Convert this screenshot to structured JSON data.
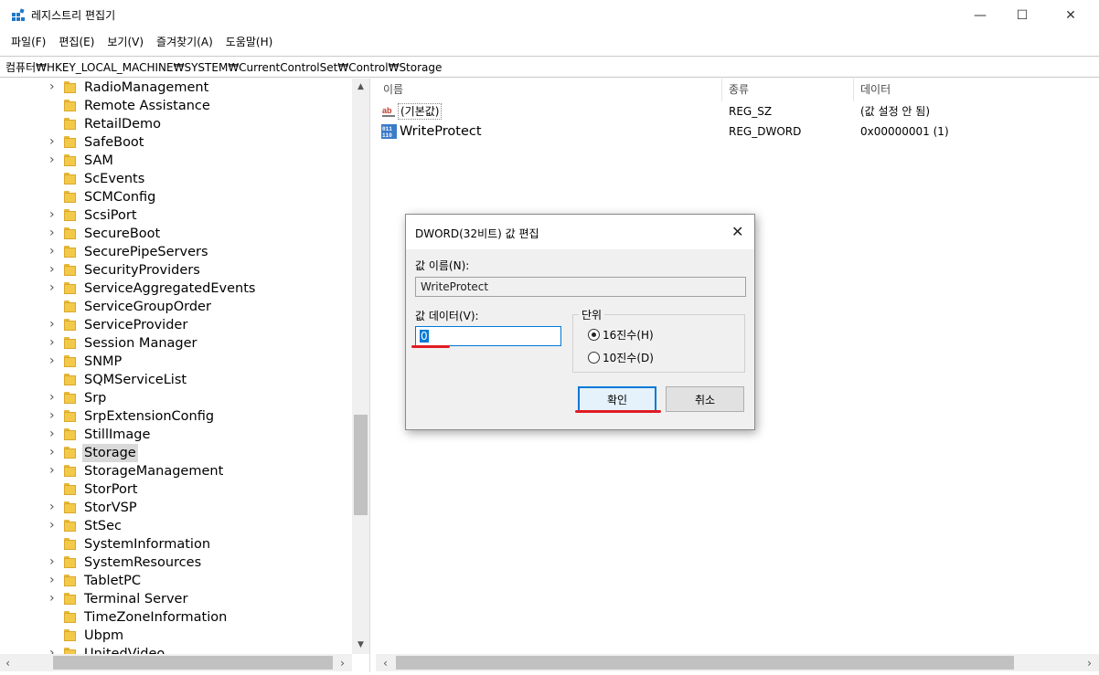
{
  "window": {
    "title": "레지스트리 편집기",
    "min_glyph": "—",
    "max_glyph": "☐",
    "close_glyph": "✕"
  },
  "menu": [
    "파일(F)",
    "편집(E)",
    "보기(V)",
    "즐겨찾기(A)",
    "도움말(H)"
  ],
  "address": "컴퓨터₩HKEY_LOCAL_MACHINE₩SYSTEM₩CurrentControlSet₩Control₩Storage",
  "tree": {
    "items": [
      {
        "label": "RadioManagement",
        "expandable": true
      },
      {
        "label": "Remote Assistance",
        "expandable": false
      },
      {
        "label": "RetailDemo",
        "expandable": false
      },
      {
        "label": "SafeBoot",
        "expandable": true
      },
      {
        "label": "SAM",
        "expandable": true
      },
      {
        "label": "ScEvents",
        "expandable": false
      },
      {
        "label": "SCMConfig",
        "expandable": false
      },
      {
        "label": "ScsiPort",
        "expandable": true
      },
      {
        "label": "SecureBoot",
        "expandable": true
      },
      {
        "label": "SecurePipeServers",
        "expandable": true
      },
      {
        "label": "SecurityProviders",
        "expandable": true
      },
      {
        "label": "ServiceAggregatedEvents",
        "expandable": true
      },
      {
        "label": "ServiceGroupOrder",
        "expandable": false
      },
      {
        "label": "ServiceProvider",
        "expandable": true
      },
      {
        "label": "Session Manager",
        "expandable": true
      },
      {
        "label": "SNMP",
        "expandable": true
      },
      {
        "label": "SQMServiceList",
        "expandable": false
      },
      {
        "label": "Srp",
        "expandable": true
      },
      {
        "label": "SrpExtensionConfig",
        "expandable": true
      },
      {
        "label": "StillImage",
        "expandable": true
      },
      {
        "label": "Storage",
        "expandable": true,
        "selected": true
      },
      {
        "label": "StorageManagement",
        "expandable": true
      },
      {
        "label": "StorPort",
        "expandable": false
      },
      {
        "label": "StorVSP",
        "expandable": true
      },
      {
        "label": "StSec",
        "expandable": true
      },
      {
        "label": "SystemInformation",
        "expandable": false
      },
      {
        "label": "SystemResources",
        "expandable": true
      },
      {
        "label": "TabletPC",
        "expandable": true
      },
      {
        "label": "Terminal Server",
        "expandable": true
      },
      {
        "label": "TimeZoneInformation",
        "expandable": false
      },
      {
        "label": "Ubpm",
        "expandable": false
      },
      {
        "label": "UnitedVideo",
        "expandable": true
      }
    ]
  },
  "list": {
    "columns": [
      "이름",
      "종류",
      "데이터"
    ],
    "rows": [
      {
        "name": "(기본값)",
        "type": "REG_SZ",
        "data": "(값 설정 안 됨)",
        "icon": "ab"
      },
      {
        "name": "WriteProtect",
        "type": "REG_DWORD",
        "data": "0x00000001 (1)",
        "icon": "dword"
      }
    ]
  },
  "dialog": {
    "title": "DWORD(32비트) 값 편집",
    "close_glyph": "✕",
    "name_label": "값 이름(N):",
    "name_value": "WriteProtect",
    "data_label": "값 데이터(V):",
    "data_value": "0",
    "base_label": "단위",
    "radio_hex": "16진수(H)",
    "radio_dec": "10진수(D)",
    "selected_base": "hex",
    "ok": "확인",
    "cancel": "취소",
    "highlight_color": "#e01b24"
  }
}
